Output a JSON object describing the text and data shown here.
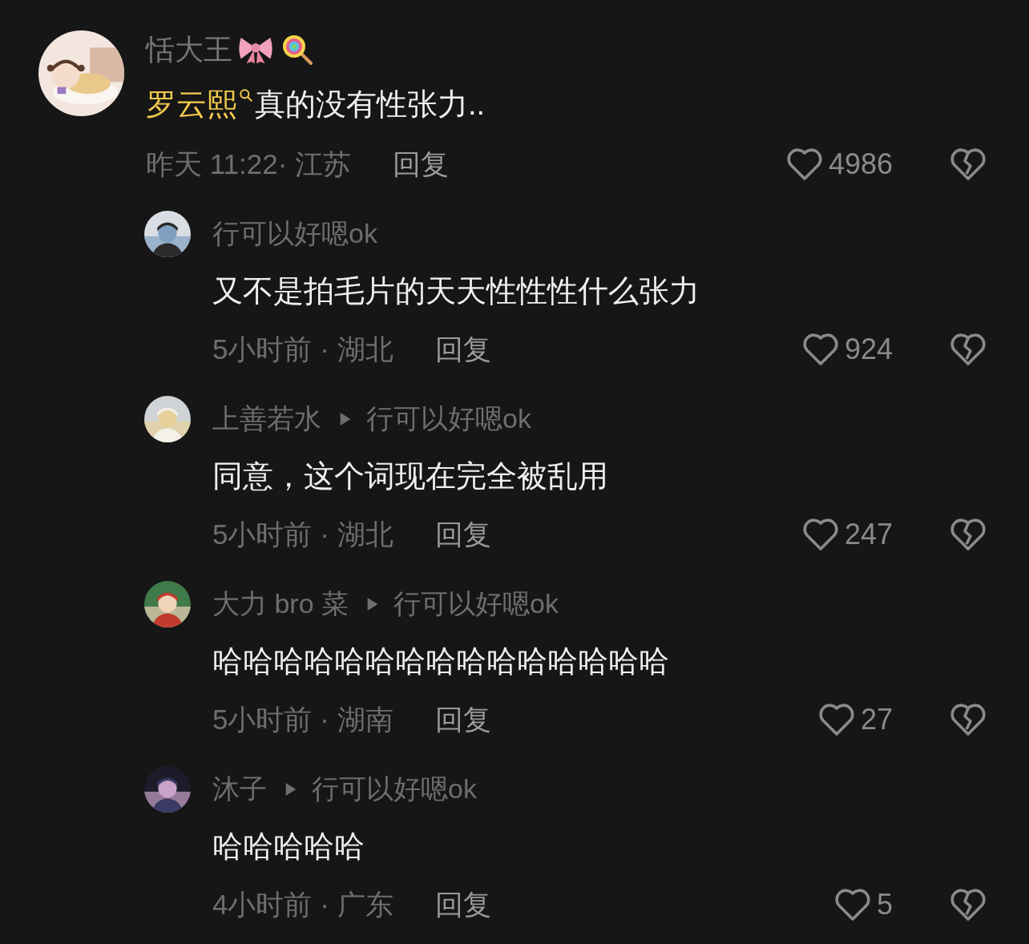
{
  "comment": {
    "user": "恬大王",
    "text": {
      "link": "罗云熙",
      "rest": "真的没有性张力.."
    },
    "time": "昨天 11:22· 江苏",
    "reply_label": "回复",
    "likes": "4986",
    "replies": [
      {
        "user": "行可以好嗯ok",
        "text": "又不是拍毛片的天天性性性什么张力",
        "time": "5小时前 · 湖北",
        "reply_label": "回复",
        "likes": "924"
      },
      {
        "user": "上善若水",
        "reply_to": "行可以好嗯ok",
        "text": "同意，这个词现在完全被乱用",
        "time": "5小时前 · 湖北",
        "reply_label": "回复",
        "likes": "247"
      },
      {
        "user": "大力 bro 菜",
        "reply_to": "行可以好嗯ok",
        "text": "哈哈哈哈哈哈哈哈哈哈哈哈哈哈哈",
        "time": "5小时前 · 湖南",
        "reply_label": "回复",
        "likes": "27"
      },
      {
        "user": "沐子",
        "reply_to": "行可以好嗯ok",
        "text": "哈哈哈哈哈",
        "time": "4小时前 · 广东",
        "reply_label": "回复",
        "likes": "5"
      }
    ]
  }
}
